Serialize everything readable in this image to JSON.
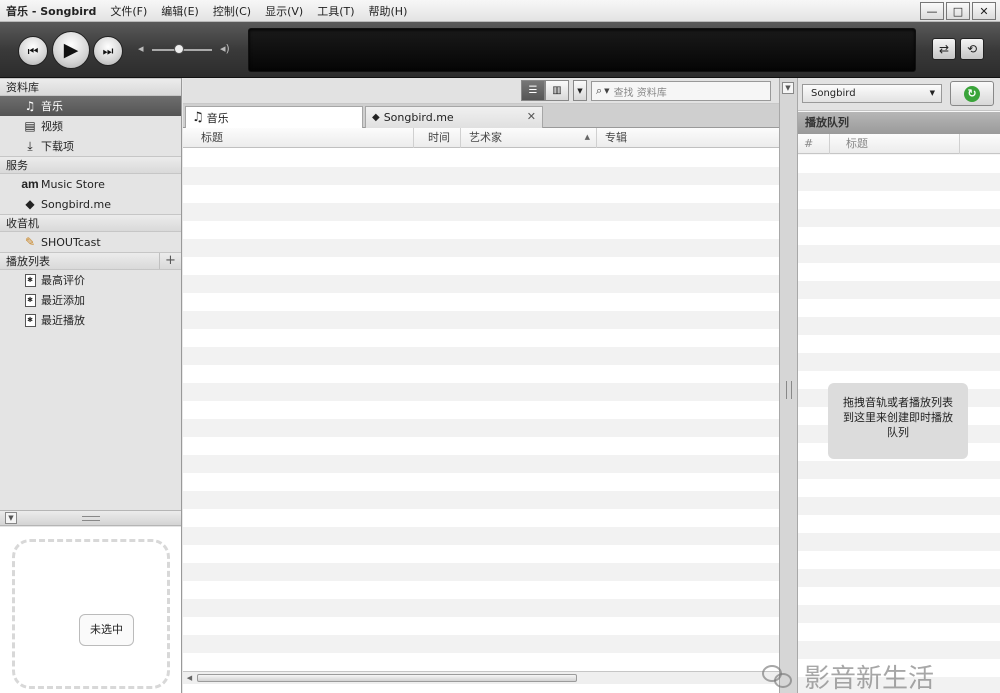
{
  "window": {
    "title": "音乐 - Songbird",
    "menus": [
      "文件(F)",
      "编辑(E)",
      "控制(C)",
      "显示(V)",
      "工具(T)",
      "帮助(H)"
    ],
    "controls": {
      "minimize": "—",
      "maximize": "□",
      "close": "✕"
    }
  },
  "player": {
    "prev_icon": "⏮",
    "play_icon": "▶",
    "next_icon": "⏭",
    "volume_low_icon": "◂",
    "volume_high_icon": "◂)",
    "shuffle_icon": "⇄",
    "repeat_icon": "⟲",
    "volume_level": 0.45
  },
  "sidebar": {
    "sections": [
      {
        "header": "资料库",
        "items": [
          {
            "label": "音乐",
            "icon": "music-note-icon",
            "selected": true
          },
          {
            "label": "视频",
            "icon": "film-icon"
          },
          {
            "label": "下载项",
            "icon": "download-icon"
          }
        ]
      },
      {
        "header": "服务",
        "items": [
          {
            "label": "Music Store",
            "icon": "amazon-icon"
          },
          {
            "label": "Songbird.me",
            "icon": "songbird-icon"
          }
        ]
      },
      {
        "header": "收音机",
        "items": [
          {
            "label": "SHOUTcast",
            "icon": "radio-icon"
          }
        ]
      },
      {
        "header": "播放列表",
        "items": [
          {
            "label": "最高评价",
            "icon": "playlist-icon"
          },
          {
            "label": "最近添加",
            "icon": "playlist-icon"
          },
          {
            "label": "最近播放",
            "icon": "playlist-icon"
          }
        ]
      }
    ],
    "add_playlist": "+",
    "amazon_text": "am",
    "albumart_button": "未选中"
  },
  "main": {
    "search_placeholder": "查找 资料库",
    "tabs": [
      {
        "label": "音乐"
      },
      {
        "label": "Songbird.me"
      }
    ],
    "tab_close": "✕",
    "columns": {
      "title": "标题",
      "time": "时间",
      "artist": "艺术家",
      "album": "专辑"
    }
  },
  "rightpane": {
    "select_value": "Songbird",
    "header": "播放队列",
    "col_num": "#",
    "col_title": "标题",
    "hint": "拖拽音轨或者播放列表到这里来创建即时播放队列"
  },
  "watermark": "影音新生活"
}
